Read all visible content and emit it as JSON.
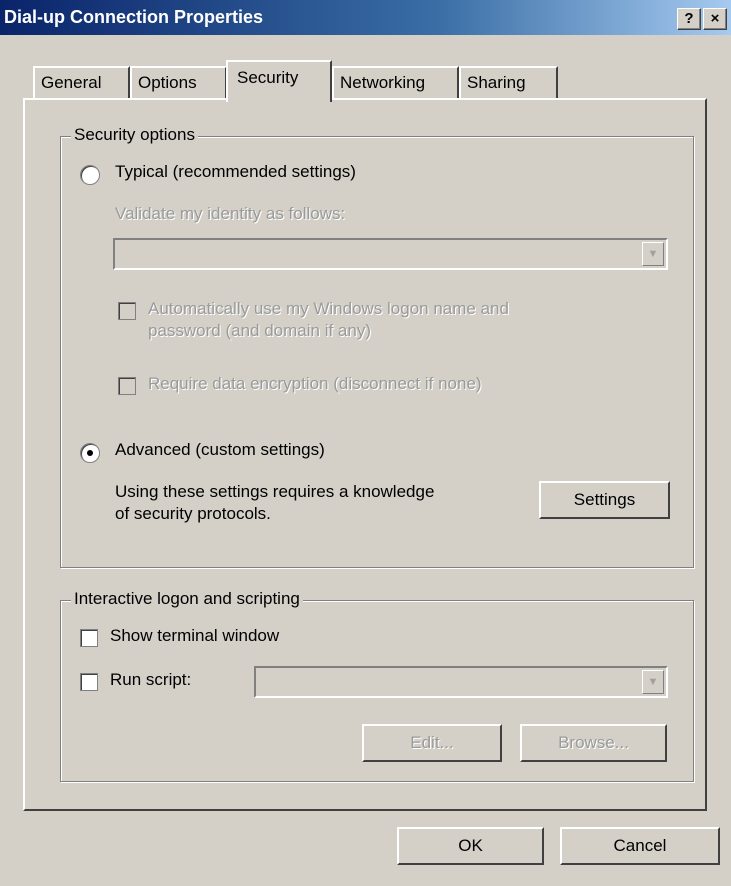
{
  "window": {
    "title": "Dial-up Connection Properties",
    "help_label": "?",
    "close_label": "×"
  },
  "tabs": [
    {
      "label": "General",
      "active": false
    },
    {
      "label": "Options",
      "active": false
    },
    {
      "label": "Security",
      "active": true
    },
    {
      "label": "Networking",
      "active": false
    },
    {
      "label": "Sharing",
      "active": false
    }
  ],
  "security_options": {
    "group_label": "Security options",
    "typical_label": "Typical (recommended settings)",
    "typical_selected": false,
    "validate_label": "Validate my identity as follows:",
    "validate_value": "",
    "auto_logon_line1": "Automatically use my Windows logon name and",
    "auto_logon_line2": "password (and domain if any)",
    "require_encryption_label": "Require data encryption (disconnect if none)",
    "advanced_label": "Advanced (custom settings)",
    "advanced_selected": true,
    "advanced_desc_line1": "Using these settings requires a knowledge",
    "advanced_desc_line2": "of security protocols.",
    "settings_button": "Settings"
  },
  "interactive": {
    "group_label": "Interactive logon and scripting",
    "show_terminal_label": "Show terminal window",
    "run_script_label": "Run script:",
    "script_value": "",
    "edit_button": "Edit...",
    "browse_button": "Browse..."
  },
  "footer": {
    "ok_button": "OK",
    "cancel_button": "Cancel"
  }
}
